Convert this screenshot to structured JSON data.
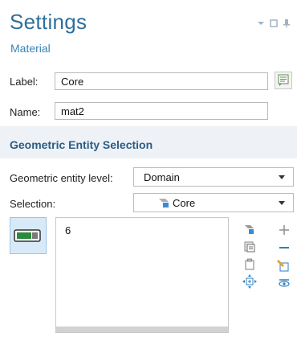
{
  "panel": {
    "title": "Settings",
    "subtitle": "Material"
  },
  "form": {
    "label_caption": "Label:",
    "label_value": "Core",
    "name_caption": "Name:",
    "name_value": "mat2"
  },
  "geometric_entity_selection": {
    "section_title": "Geometric Entity Selection",
    "entity_level_caption": "Geometric entity level:",
    "entity_level_value": "Domain",
    "selection_caption": "Selection:",
    "selection_value": "Core",
    "selected_items": [
      "6"
    ]
  },
  "colors": {
    "title": "#2f6f9a",
    "subtitle": "#3a84b5",
    "section_title": "#2c5c84",
    "active_toggle": "#d8eaf7",
    "plus_minus_blue": "#2f7fbf"
  },
  "icons": {
    "window_controls": [
      "dropdown-triangle-icon",
      "maximize-icon",
      "pin-icon"
    ],
    "tools_left": [
      "add-to-selection-icon",
      "paste-selection-icon",
      "copy-selection-icon",
      "zoom-to-selection-icon"
    ],
    "tools_right": [
      "plus-icon",
      "minus-icon",
      "clear-selection-icon",
      "show-selection-icon"
    ]
  }
}
